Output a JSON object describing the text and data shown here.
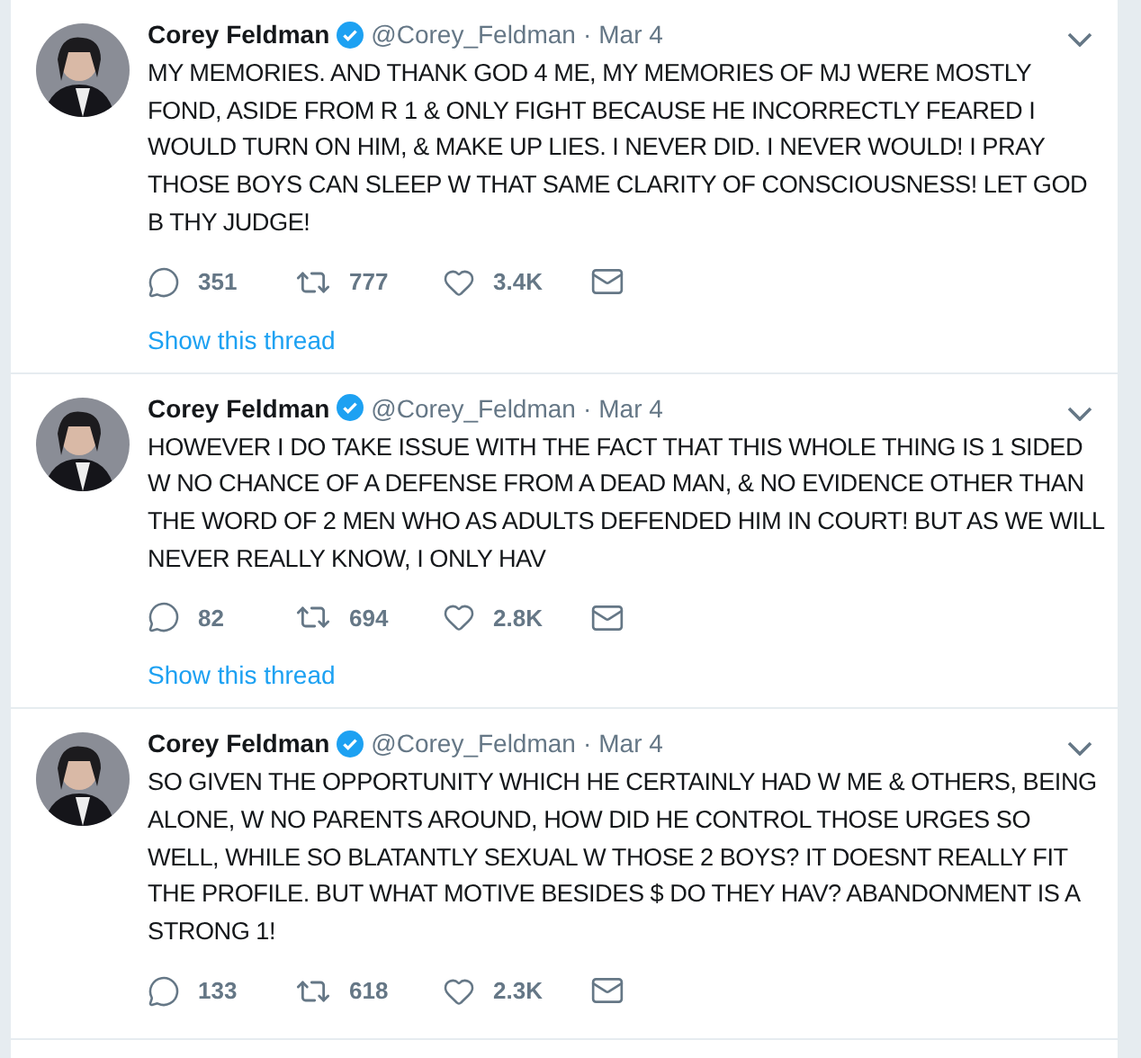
{
  "tweets": [
    {
      "name": "Corey Feldman",
      "verified": true,
      "handle": "@Corey_Feldman",
      "separator": "·",
      "date": "Mar 4",
      "text": "MY MEMORIES. AND THANK GOD 4 ME, MY MEMORIES OF MJ WERE MOSTLY FOND, ASIDE FROM R 1 & ONLY FIGHT BECAUSE HE INCORRECTLY FEARED I WOULD TURN ON HIM, & MAKE UP LIES. I NEVER DID. I NEVER WOULD!  I PRAY THOSE BOYS CAN SLEEP W THAT SAME CLARITY OF CONSCIOUSNESS! LET GOD B THY JUDGE!",
      "replies": "351",
      "retweets": "777",
      "likes": "3.4K",
      "thread_link": "Show this thread"
    },
    {
      "name": "Corey Feldman",
      "verified": true,
      "handle": "@Corey_Feldman",
      "separator": "·",
      "date": "Mar 4",
      "text": "HOWEVER I DO TAKE ISSUE WITH THE FACT THAT THIS WHOLE THING IS 1 SIDED W NO CHANCE OF A DEFENSE FROM A DEAD MAN, & NO EVIDENCE OTHER THAN THE WORD OF 2 MEN WHO AS ADULTS DEFENDED HIM IN COURT! BUT AS WE WILL NEVER REALLY KNOW, I ONLY HAV",
      "replies": "82",
      "retweets": "694",
      "likes": "2.8K",
      "thread_link": "Show this thread"
    },
    {
      "name": "Corey Feldman",
      "verified": true,
      "handle": "@Corey_Feldman",
      "separator": "·",
      "date": "Mar 4",
      "text": "SO GIVEN THE OPPORTUNITY WHICH HE CERTAINLY HAD W ME & OTHERS, BEING ALONE, W NO PARENTS AROUND, HOW DID HE CONTROL THOSE URGES SO WELL, WHILE SO BLATANTLY SEXUAL W THOSE 2 BOYS? IT DOESNT REALLY FIT THE PROFILE. BUT WHAT MOTIVE BESIDES $ DO THEY HAV? ABANDONMENT IS A STRONG 1!",
      "replies": "133",
      "retweets": "618",
      "likes": "2.3K"
    }
  ]
}
